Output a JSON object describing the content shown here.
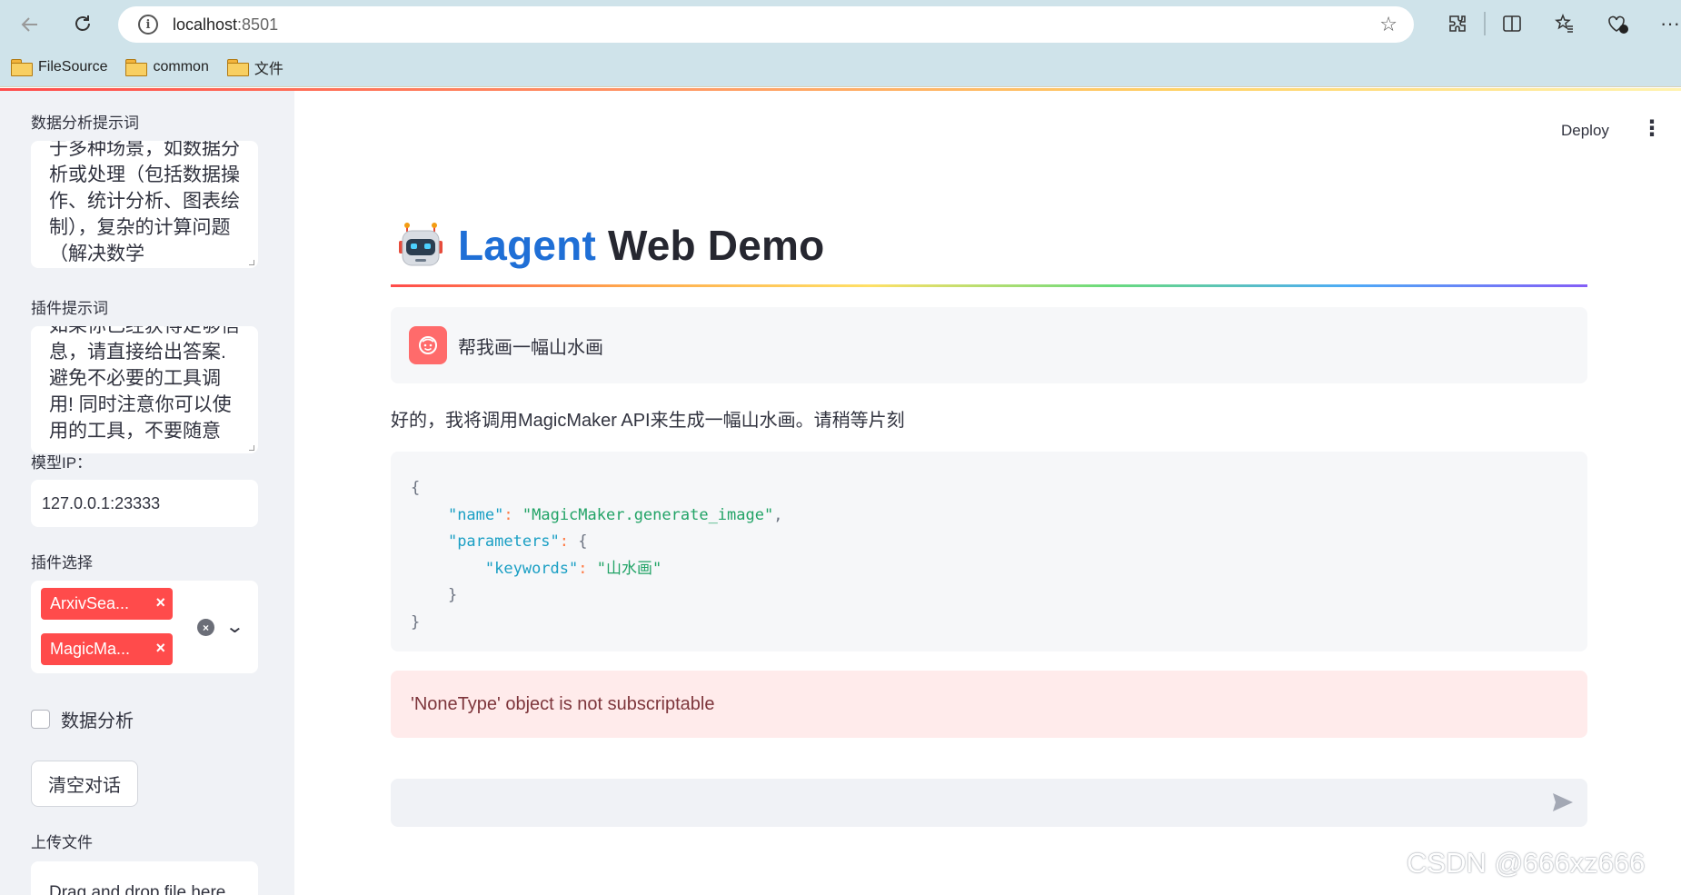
{
  "browser": {
    "url_host": "localhost",
    "url_port": ":8501",
    "bookmarks": [
      {
        "label": "FileSource"
      },
      {
        "label": "common"
      },
      {
        "label": "文件"
      }
    ]
  },
  "sidebar": {
    "data_prompt_label": "数据分析提示词",
    "data_prompt_value": "于多种场景，如数据分析或处理（包括数据操作、统计分析、图表绘制），复杂的计算问题（解决数学",
    "plugin_prompt_label": "插件提示词",
    "plugin_prompt_value": "如果你已经获得足够信息，请直接给出答案. 避免不必要的工具调用! 同时注意你可以使用的工具，不要随意",
    "model_ip_label": "模型IP：",
    "model_ip_value": "127.0.0.1:23333",
    "plugin_select_label": "插件选择",
    "plugins": [
      {
        "label": "ArxivSea..."
      },
      {
        "label": "MagicMa..."
      }
    ],
    "data_analysis_checkbox": "数据分析",
    "clear_button": "清空对话",
    "upload_label": "上传文件",
    "upload_hint": "Drag and drop file here"
  },
  "header": {
    "deploy": "Deploy",
    "menu_icon": "⋮"
  },
  "main": {
    "title_brand": "Lagent",
    "title_rest": " Web Demo",
    "user_message": "帮我画一幅山水画",
    "assistant_message": "好的，我将调用MagicMaker API来生成一幅山水画。请稍等片刻",
    "code": {
      "key_name": "\"name\"",
      "val_name": "\"MagicMaker.generate_image\"",
      "key_parameters": "\"parameters\"",
      "key_keywords": "\"keywords\"",
      "val_keywords": "\"山水画\""
    },
    "error_message": "'NoneType' object is not subscriptable"
  },
  "watermark": "CSDN @666xz666",
  "colors": {
    "accent_red": "#ff4b4b",
    "brand_blue": "#1f6fd6",
    "error_bg": "#ffebeb"
  }
}
